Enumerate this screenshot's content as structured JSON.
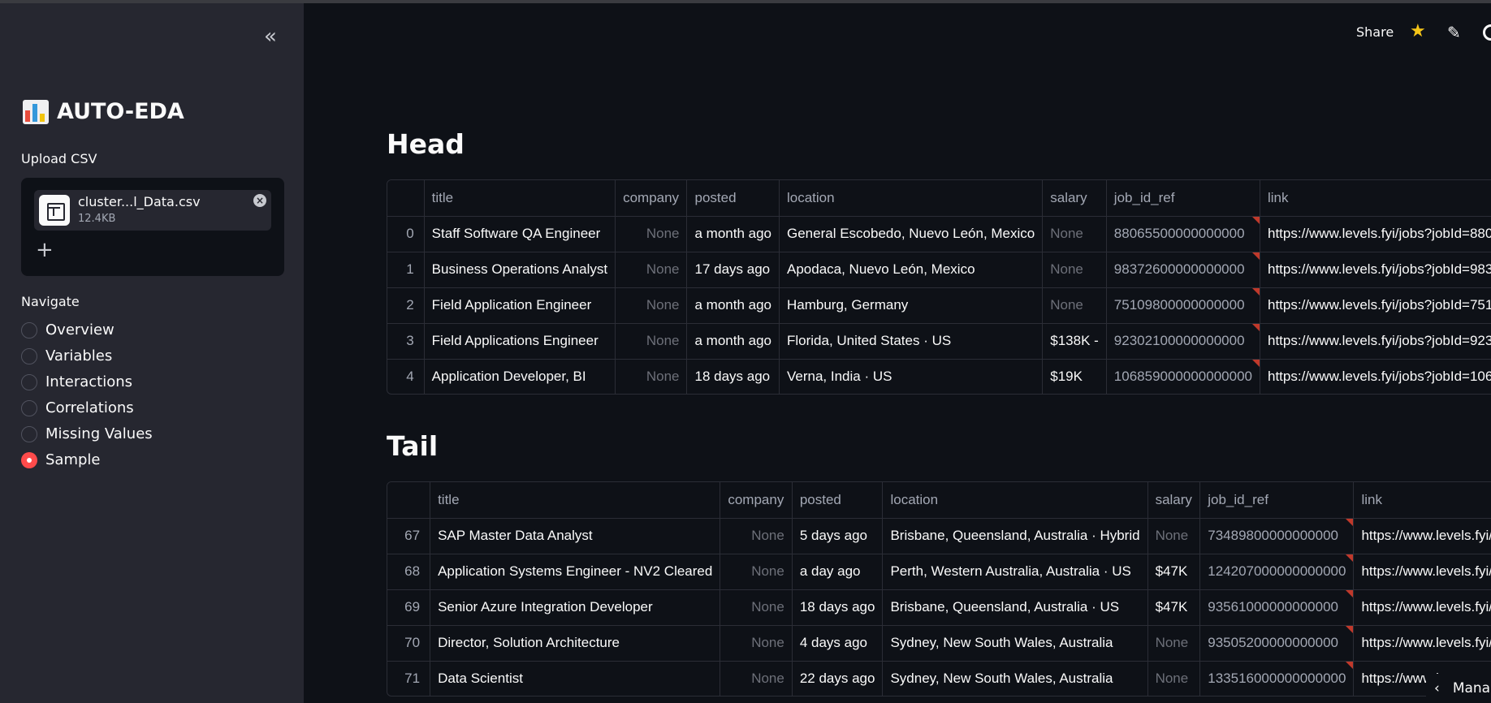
{
  "sidebar": {
    "collapse_glyph": "«",
    "app_title": "AUTO-EDA",
    "upload_label": "Upload CSV",
    "file": {
      "name": "cluster...l_Data.csv",
      "size": "12.4KB"
    },
    "navigate_label": "Navigate",
    "nav_items": [
      {
        "label": "Overview",
        "selected": false
      },
      {
        "label": "Variables",
        "selected": false
      },
      {
        "label": "Interactions",
        "selected": false
      },
      {
        "label": "Correlations",
        "selected": false
      },
      {
        "label": "Missing Values",
        "selected": false
      },
      {
        "label": "Sample",
        "selected": true
      }
    ]
  },
  "header": {
    "share_label": "Share"
  },
  "head_section": {
    "title": "Head",
    "columns": [
      "title",
      "company",
      "posted",
      "location",
      "salary",
      "job_id_ref",
      "link"
    ],
    "rows": [
      {
        "index": "0",
        "title": "Staff Software QA Engineer",
        "company": "None",
        "posted": "a month ago",
        "location": "General Escobedo, Nuevo León, Mexico",
        "salary": "None",
        "job_id_ref": "88065500000000000",
        "link": "https://www.levels.fyi/jobs?jobId=880"
      },
      {
        "index": "1",
        "title": "Business Operations Analyst",
        "company": "None",
        "posted": "17 days ago",
        "location": "Apodaca, Nuevo León, Mexico",
        "salary": "None",
        "job_id_ref": "98372600000000000",
        "link": "https://www.levels.fyi/jobs?jobId=983"
      },
      {
        "index": "2",
        "title": "Field Application Engineer",
        "company": "None",
        "posted": "a month ago",
        "location": "Hamburg, Germany",
        "salary": "None",
        "job_id_ref": "75109800000000000",
        "link": "https://www.levels.fyi/jobs?jobId=751"
      },
      {
        "index": "3",
        "title": "Field Applications Engineer",
        "company": "None",
        "posted": "a month ago",
        "location": "Florida, United States · US",
        "salary": "$138K -",
        "job_id_ref": "92302100000000000",
        "link": "https://www.levels.fyi/jobs?jobId=923"
      },
      {
        "index": "4",
        "title": "Application Developer, BI",
        "company": "None",
        "posted": "18 days ago",
        "location": "Verna, India · US",
        "salary": "$19K",
        "job_id_ref": "106859000000000000",
        "link": "https://www.levels.fyi/jobs?jobId=106"
      }
    ]
  },
  "tail_section": {
    "title": "Tail",
    "columns": [
      "title",
      "company",
      "posted",
      "location",
      "salary",
      "job_id_ref",
      "link"
    ],
    "rows": [
      {
        "index": "67",
        "title": "SAP Master Data Analyst",
        "company": "None",
        "posted": "5 days ago",
        "location": "Brisbane, Queensland, Australia · Hybrid",
        "salary": "None",
        "job_id_ref": "73489800000000000",
        "link": "https://www.levels.fyi/j"
      },
      {
        "index": "68",
        "title": "Application Systems Engineer - NV2 Cleared",
        "company": "None",
        "posted": "a day ago",
        "location": "Perth, Western Australia, Australia · US",
        "salary": "$47K",
        "job_id_ref": "124207000000000000",
        "link": "https://www.levels.fyi/j"
      },
      {
        "index": "69",
        "title": "Senior Azure Integration Developer",
        "company": "None",
        "posted": "18 days ago",
        "location": "Brisbane, Queensland, Australia · US",
        "salary": "$47K",
        "job_id_ref": "93561000000000000",
        "link": "https://www.levels.fyi/j"
      },
      {
        "index": "70",
        "title": "Director, Solution Architecture",
        "company": "None",
        "posted": "4 days ago",
        "location": "Sydney, New South Wales, Australia",
        "salary": "None",
        "job_id_ref": "93505200000000000",
        "link": "https://www.levels.fyi/j"
      },
      {
        "index": "71",
        "title": "Data Scientist",
        "company": "None",
        "posted": "22 days ago",
        "location": "Sydney, New South Wales, Australia",
        "salary": "None",
        "job_id_ref": "133516000000000000",
        "link": "https://www.l"
      }
    ]
  },
  "manage_app": {
    "label": "Mana"
  },
  "colors": {
    "accent": "#ff4b4b",
    "sidebar_bg": "#262730",
    "main_bg": "#0e1117",
    "star": "#f5c518"
  }
}
